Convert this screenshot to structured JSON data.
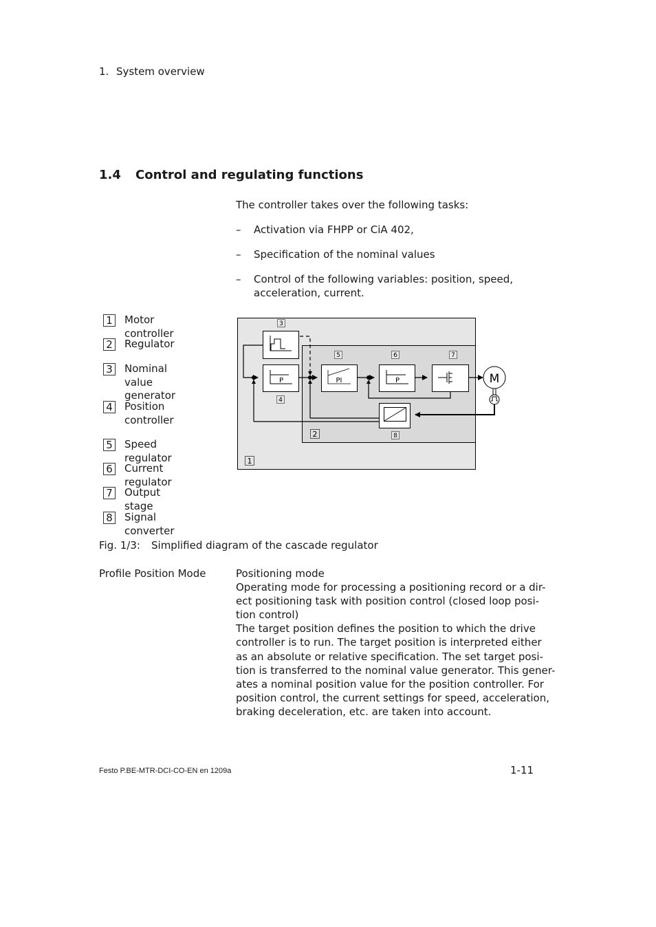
{
  "header": {
    "chapter_number": "1.",
    "chapter_title": "System overview"
  },
  "section": {
    "number": "1.4",
    "title": "Control and regulating functions"
  },
  "intro": {
    "lead": "The controller takes over the following tasks:",
    "bullets": [
      {
        "dash": "–",
        "lines": [
          "Activation via FHPP or CiA 402,"
        ]
      },
      {
        "dash": "–",
        "lines": [
          "Specification of the nominal values"
        ]
      },
      {
        "dash": "–",
        "lines": [
          "Control of the following variables: position, speed,",
          "acceleration, current."
        ]
      }
    ]
  },
  "legend": [
    {
      "num": "1",
      "label": "Motor controller"
    },
    {
      "num": "2",
      "label": "Regulator"
    },
    {
      "num": "3",
      "label": "Nominal\nvalue generator"
    },
    {
      "num": "4",
      "label": "Position\ncontroller"
    },
    {
      "num": "5",
      "label": "Speed regulator"
    },
    {
      "num": "6",
      "label": "Current regulator"
    },
    {
      "num": "7",
      "label": "Output stage"
    },
    {
      "num": "8",
      "label": "Signal converter"
    }
  ],
  "diagram": {
    "blocks": {
      "position_controller": "P",
      "speed_regulator": "PI",
      "current_regulator": "P",
      "motor": "M"
    },
    "markers": [
      "1",
      "2",
      "3",
      "4",
      "5",
      "6",
      "7",
      "8"
    ],
    "colors": {
      "outer_fill": "#e6e6e6",
      "inner_fill": "#d9d9d9",
      "block_fill": "#ffffff",
      "line": "#000000"
    }
  },
  "caption": {
    "number": "Fig. 1/3:",
    "text": "Simplified diagram of the cascade regulator"
  },
  "definition": {
    "term": "Profile Position Mode",
    "lines": [
      "Positioning mode",
      "Operating mode for processing a positioning record or a dir-",
      "ect positioning task with position control (closed loop posi-",
      "tion control)",
      "The target position defines the position to which the drive",
      "controller is to run. The target position is interpreted either",
      "as an absolute or relative specification. The set target posi-",
      "tion is transferred to the nominal value generator. This gener-",
      "ates a nominal position value for the position controller. For",
      "position control, the current settings for speed, acceleration,",
      "braking deceleration, etc. are taken into account."
    ]
  },
  "footer": {
    "doc_id": "Festo P.BE-MTR-DCI-CO-EN  en 1209a",
    "page": "1-11"
  }
}
